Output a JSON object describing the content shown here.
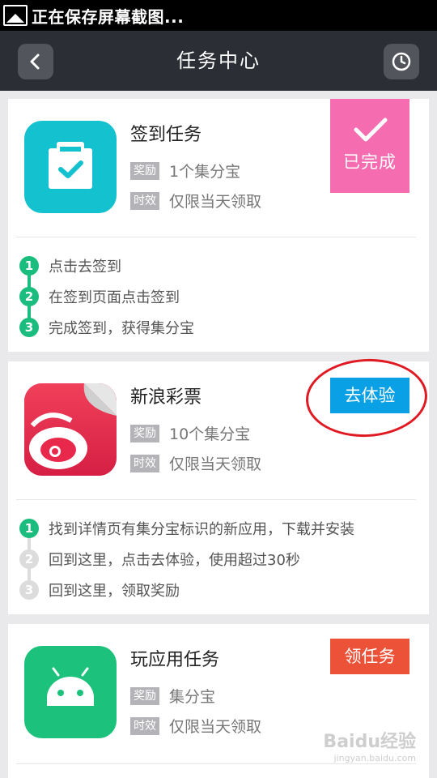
{
  "status_bar": {
    "text": "正在保存屏幕截图..."
  },
  "header": {
    "title": "任务中心"
  },
  "tasks": [
    {
      "name": "签到任务",
      "reward_tag": "奖励",
      "reward": "1个集分宝",
      "time_tag": "时效",
      "time": "仅限当天领取",
      "badge": "已完成",
      "steps": [
        {
          "num": "1",
          "text": "点击去签到"
        },
        {
          "num": "2",
          "text": "在签到页面点击签到"
        },
        {
          "num": "3",
          "text": "完成签到，获得集分宝"
        }
      ]
    },
    {
      "name": "新浪彩票",
      "reward_tag": "奖励",
      "reward": "10个集分宝",
      "time_tag": "时效",
      "time": "仅限当天领取",
      "button": "去体验",
      "steps": [
        {
          "num": "1",
          "text": "找到详情页有集分宝标识的新应用，下载并安装"
        },
        {
          "num": "2",
          "text": "回到这里，点击去体验，使用超过30秒"
        },
        {
          "num": "3",
          "text": "回到这里，领取奖励"
        }
      ]
    },
    {
      "name": "玩应用任务",
      "reward_tag": "奖励",
      "reward": "集分宝",
      "time_tag": "时效",
      "time": "仅限当天领取",
      "button": "领任务"
    }
  ],
  "watermark": {
    "text": "Baidu经验",
    "sub": "jingyan.baidu.com"
  },
  "colors": {
    "header": "#2b2e35",
    "accent_green": "#1bbd7e",
    "blue_button": "#0aa0e5",
    "red_button": "#ec5238",
    "done_badge": "#f56db0"
  }
}
